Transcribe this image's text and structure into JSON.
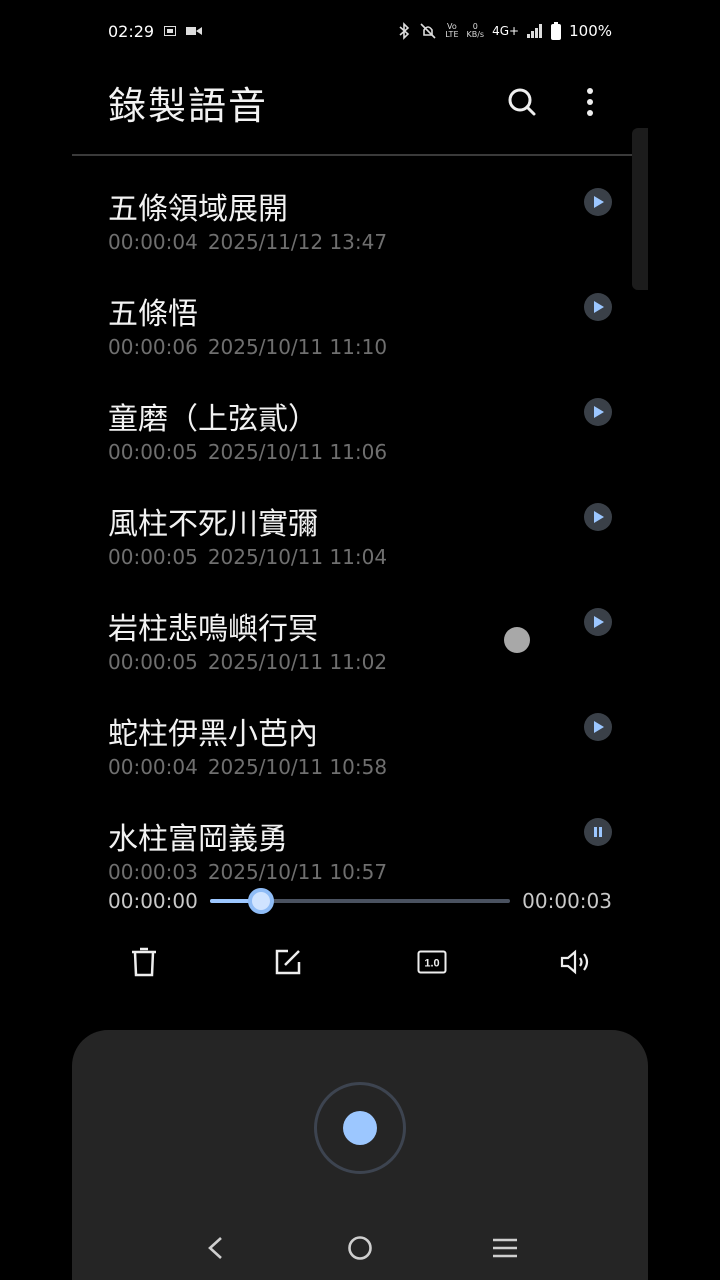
{
  "status": {
    "time": "02:29",
    "vo_top": "Vo",
    "vo_bottom": "LTE",
    "kbs_top": "0",
    "kbs_bottom": "KB/s",
    "network": "4G+",
    "battery": "100%"
  },
  "header": {
    "title": "錄製語音"
  },
  "recordings": [
    {
      "title": "五條領域展開",
      "duration": "00:00:04",
      "date": "2025/11/12 13:47",
      "state": "play"
    },
    {
      "title": "五條悟",
      "duration": "00:00:06",
      "date": "2025/10/11 11:10",
      "state": "play"
    },
    {
      "title": "童磨（上弦貳）",
      "duration": "00:00:05",
      "date": "2025/10/11 11:06",
      "state": "play"
    },
    {
      "title": "風柱不死川實彌",
      "duration": "00:00:05",
      "date": "2025/10/11 11:04",
      "state": "play"
    },
    {
      "title": "岩柱悲鳴嶼行冥",
      "duration": "00:00:05",
      "date": "2025/10/11 11:02",
      "state": "play"
    },
    {
      "title": "蛇柱伊黑小芭內",
      "duration": "00:00:04",
      "date": "2025/10/11 10:58",
      "state": "play"
    },
    {
      "title": "水柱富岡義勇",
      "duration": "00:00:03",
      "date": "2025/10/11 10:57",
      "state": "pause"
    }
  ],
  "player": {
    "elapsed": "00:00:00",
    "total": "00:00:03",
    "progress": 0.17,
    "speed_label": "1.0"
  },
  "colors": {
    "accent": "#9cc7ff",
    "background": "#000000",
    "panel": "#252525",
    "meta_text": "#6f6f6f"
  },
  "icons": {
    "search": "search-icon",
    "more": "more-vert-icon",
    "delete": "trash-icon",
    "rename": "edit-icon",
    "speed": "speed-icon",
    "volume": "speaker-icon",
    "back": "back-icon",
    "home": "home-icon",
    "recents": "recents-icon"
  }
}
